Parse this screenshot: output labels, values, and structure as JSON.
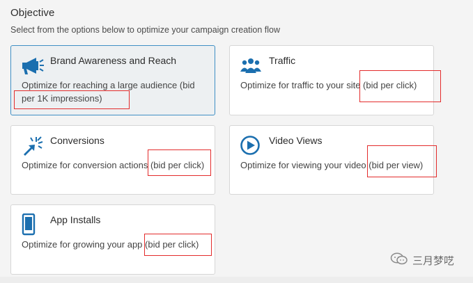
{
  "header": {
    "title": "Objective",
    "subtitle": "Select from the options below to optimize your campaign creation flow"
  },
  "options": [
    {
      "title": "Brand Awareness and Reach",
      "description": "Optimize for reaching a large audience (bid per 1K impressions)",
      "icon": "megaphone-icon",
      "selected": true
    },
    {
      "title": "Traffic",
      "description": "Optimize for traffic to your site (bid per click)",
      "icon": "people-group-icon",
      "selected": false
    },
    {
      "title": "Conversions",
      "description": "Optimize for conversion actions (bid per click)",
      "icon": "cursor-click-icon",
      "selected": false
    },
    {
      "title": "Video Views",
      "description": "Optimize for viewing your video (bid per view)",
      "icon": "play-circle-icon",
      "selected": false
    },
    {
      "title": "App Installs",
      "description": "Optimize for growing your app (bid per click)",
      "icon": "mobile-phone-icon",
      "selected": false
    }
  ],
  "watermark": {
    "text": "三月梦呓",
    "icon": "wechat-icon"
  },
  "colors": {
    "accent": "#1b6faf",
    "selected_border": "#3f8fc4",
    "annotation": "#e32b2b"
  }
}
